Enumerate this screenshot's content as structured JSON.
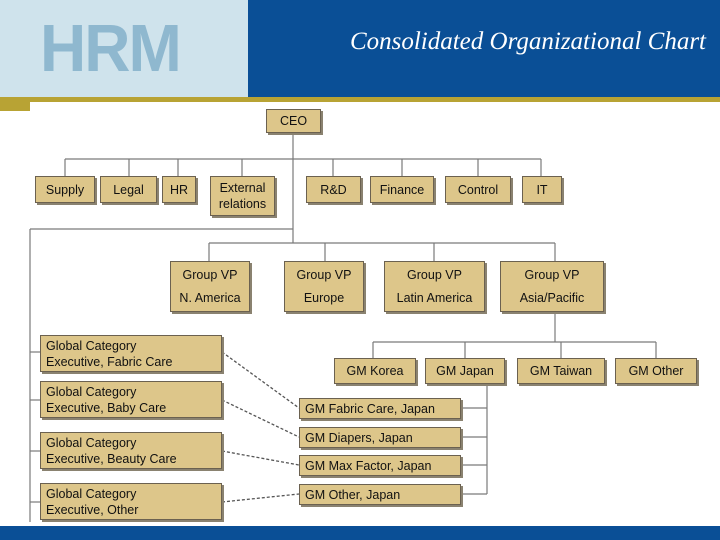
{
  "header": {
    "logo": "HRM",
    "title": "Consolidated Organizational Chart"
  },
  "colors": {
    "header_blue": "#0a4f96",
    "header_light": "#cfe3ec",
    "accent_gold": "#b8a334",
    "box_fill": "#ddc68a"
  },
  "org": {
    "ceo": "CEO",
    "functions": [
      {
        "label": "Supply"
      },
      {
        "label": "Legal"
      },
      {
        "label": "HR"
      },
      {
        "label_line1": "External",
        "label_line2": "relations"
      },
      {
        "label": "R&D"
      },
      {
        "label": "Finance"
      },
      {
        "label": "Control"
      },
      {
        "label": "IT"
      }
    ],
    "group_vps": [
      {
        "title": "Group VP",
        "region": "N. America"
      },
      {
        "title": "Group VP",
        "region": "Europe"
      },
      {
        "title": "Group VP",
        "region": "Latin America"
      },
      {
        "title": "Group VP",
        "region": "Asia/Pacific"
      }
    ],
    "general_managers": [
      {
        "label": "GM Korea"
      },
      {
        "label": "GM Japan"
      },
      {
        "label": "GM Taiwan"
      },
      {
        "label": "GM Other"
      }
    ],
    "category_executives": [
      {
        "line1": "Global Category",
        "line2": "Executive, Fabric Care"
      },
      {
        "line1": "Global Category",
        "line2": "Executive, Baby Care"
      },
      {
        "line1": "Global Category",
        "line2": "Executive, Beauty Care"
      },
      {
        "line1": "Global Category",
        "line2": "Executive, Other"
      }
    ],
    "japan_gms": [
      {
        "label": "GM Fabric Care, Japan"
      },
      {
        "label": "GM Diapers, Japan"
      },
      {
        "label": "GM Max Factor, Japan"
      },
      {
        "label": "GM Other, Japan"
      }
    ]
  }
}
